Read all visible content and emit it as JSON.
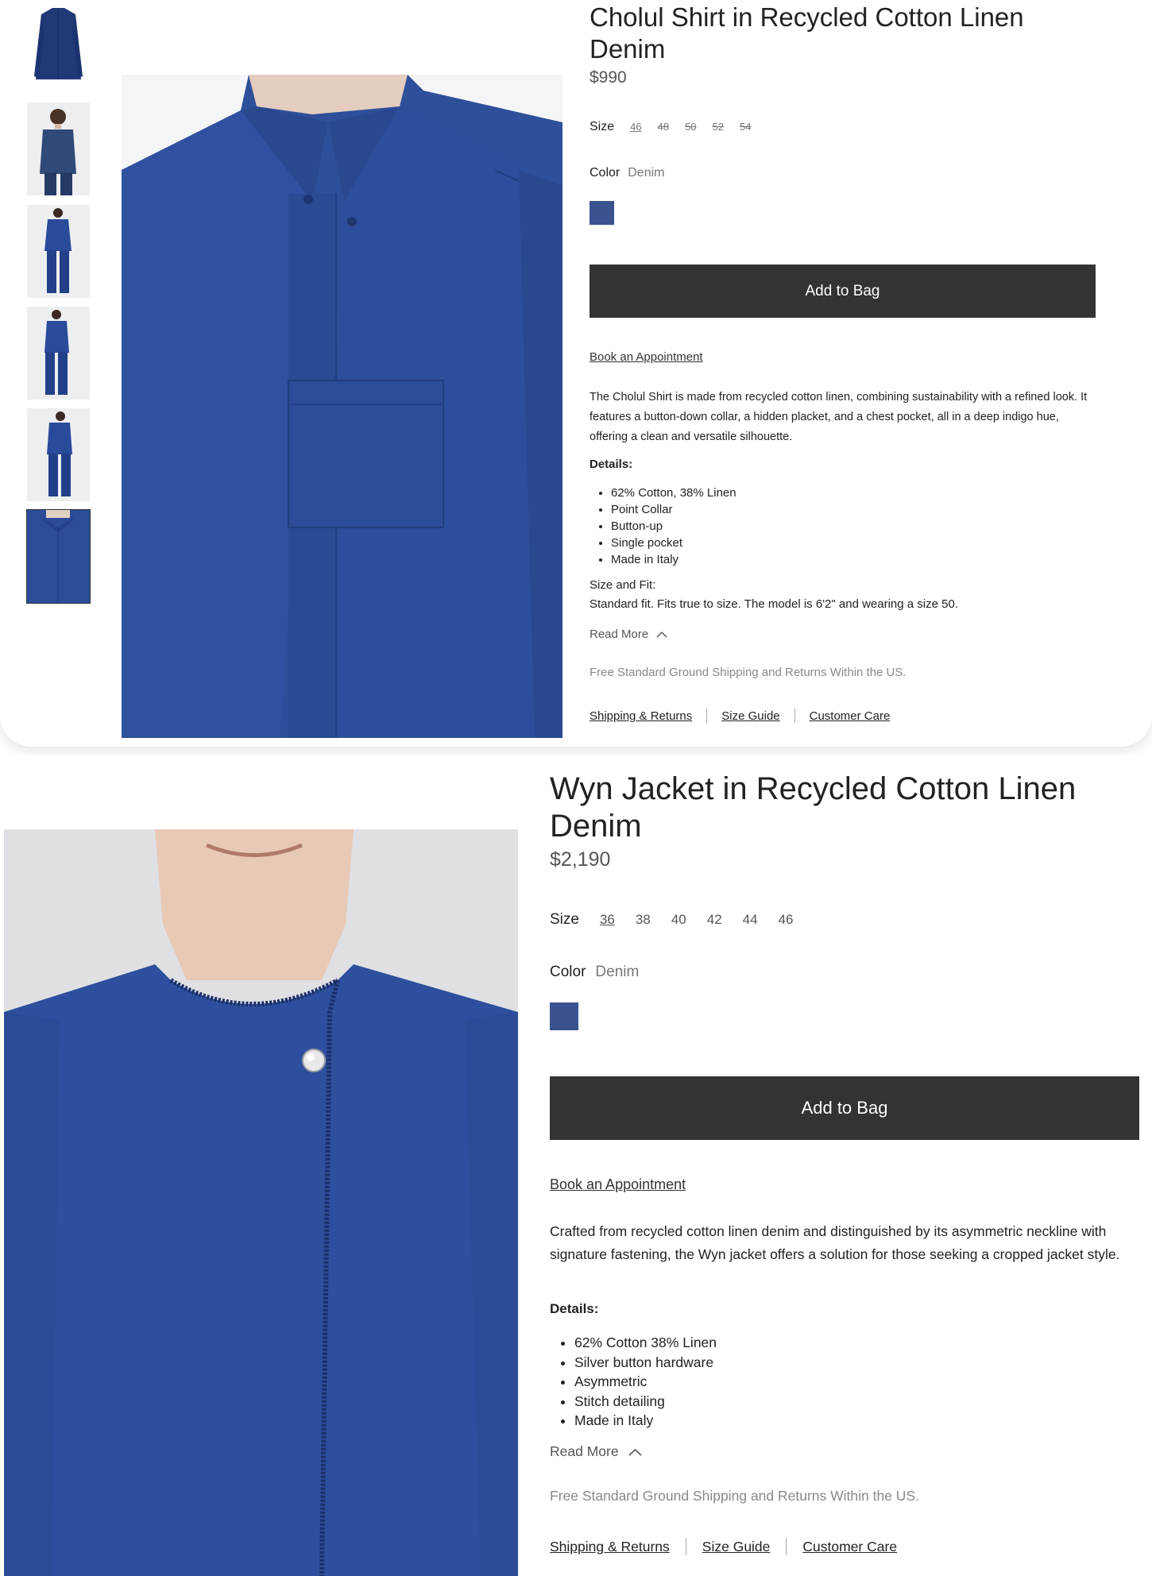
{
  "product1": {
    "title": "Cholul Shirt in Recycled Cotton Linen Denim",
    "price": "$990",
    "size_label": "Size",
    "sizes": [
      "46",
      "48",
      "50",
      "52",
      "54"
    ],
    "color_label": "Color",
    "color_value": "Denim",
    "swatch_color": "#3b5290",
    "add_to_bag": "Add to Bag",
    "book_appointment": "Book an Appointment",
    "description": "The Cholul Shirt is made from recycled cotton linen, combining sustainability with a refined look. It features a button-down collar, a hidden placket, and a chest pocket, all in a deep indigo hue, offering a clean and versatile silhouette.",
    "details_heading": "Details:",
    "details": [
      "62% Cotton, 38% Linen",
      "Point Collar",
      "Button-up",
      "Single pocket",
      "Made in Italy"
    ],
    "fit_heading": "Size and Fit:",
    "fit_text": "Standard fit. Fits true to size. The model is 6'2\" and wearing a size 50.",
    "read_more": "Read More",
    "shipping_note": "Free Standard Ground Shipping and Returns Within the US.",
    "links": [
      "Shipping & Returns",
      "Size Guide",
      "Customer Care"
    ]
  },
  "product2": {
    "title": "Wyn Jacket in Recycled Cotton Linen Denim",
    "price": "$2,190",
    "size_label": "Size",
    "sizes": [
      "36",
      "38",
      "40",
      "42",
      "44",
      "46"
    ],
    "color_label": "Color",
    "color_value": "Denim",
    "swatch_color": "#3b5290",
    "add_to_bag": "Add to Bag",
    "book_appointment": "Book an Appointment",
    "description": "Crafted from recycled cotton linen denim and distinguished by its asymmetric neckline with signature fastening, the Wyn jacket offers a solution for those seeking a cropped jacket style.",
    "details_heading": "Details:",
    "details": [
      "62% Cotton 38% Linen",
      "Silver button hardware",
      "Asymmetric",
      "Stitch detailing",
      "Made in Italy"
    ],
    "read_more": "Read More",
    "shipping_note": "Free Standard Ground Shipping and Returns Within the US.",
    "links": [
      "Shipping & Returns",
      "Size Guide",
      "Customer Care"
    ]
  },
  "icons": {
    "read_more": "chevron-up-icon"
  },
  "colors": {
    "button_bg": "#333333",
    "denim": "#2e4f9a"
  }
}
